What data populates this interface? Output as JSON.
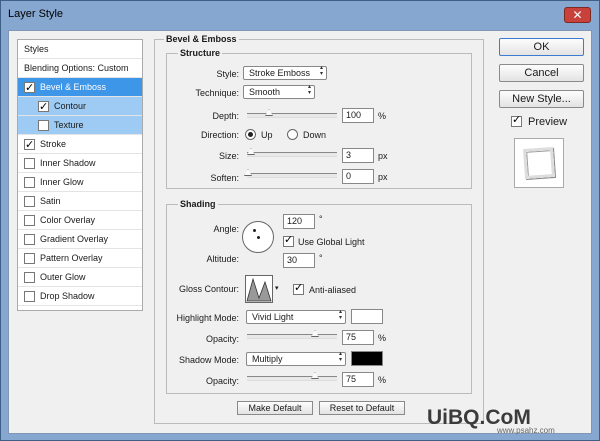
{
  "window": {
    "title": "Layer Style",
    "close_glyph": "✕"
  },
  "styles_panel": {
    "header": "Styles",
    "blending": "Blending Options: Custom",
    "items": [
      {
        "label": "Bevel & Emboss",
        "checked": true
      },
      {
        "label": "Contour",
        "checked": true
      },
      {
        "label": "Texture",
        "checked": false
      },
      {
        "label": "Stroke",
        "checked": true
      },
      {
        "label": "Inner Shadow",
        "checked": false
      },
      {
        "label": "Inner Glow",
        "checked": false
      },
      {
        "label": "Satin",
        "checked": false
      },
      {
        "label": "Color Overlay",
        "checked": false
      },
      {
        "label": "Gradient Overlay",
        "checked": false
      },
      {
        "label": "Pattern Overlay",
        "checked": false
      },
      {
        "label": "Outer Glow",
        "checked": false
      },
      {
        "label": "Drop Shadow",
        "checked": false
      }
    ]
  },
  "bevel": {
    "title": "Bevel & Emboss",
    "structure": {
      "title": "Structure",
      "style_label": "Style:",
      "style_value": "Stroke Emboss",
      "technique_label": "Technique:",
      "technique_value": "Smooth",
      "depth_label": "Depth:",
      "depth_value": "100",
      "depth_unit": "%",
      "direction_label": "Direction:",
      "dir_up": "Up",
      "dir_down": "Down",
      "size_label": "Size:",
      "size_value": "3",
      "size_unit": "px",
      "soften_label": "Soften:",
      "soften_value": "0",
      "soften_unit": "px"
    },
    "shading": {
      "title": "Shading",
      "angle_label": "Angle:",
      "angle_value": "120",
      "deg": "°",
      "global_light": "Use Global Light",
      "altitude_label": "Altitude:",
      "altitude_value": "30",
      "gloss_label": "Gloss Contour:",
      "anti_aliased": "Anti-aliased",
      "highlight_label": "Highlight Mode:",
      "highlight_value": "Vivid Light",
      "highlight_color": "#ffffff",
      "hl_opacity_label": "Opacity:",
      "hl_opacity_value": "75",
      "pct": "%",
      "shadow_label": "Shadow Mode:",
      "shadow_value": "Multiply",
      "shadow_color": "#000000",
      "sh_opacity_label": "Opacity:",
      "sh_opacity_value": "75"
    },
    "make_default": "Make Default",
    "reset_default": "Reset to Default"
  },
  "buttons": {
    "ok": "OK",
    "cancel": "Cancel",
    "new_style": "New Style...",
    "preview": "Preview"
  },
  "watermark": {
    "brand": "UiBQ.CoM",
    "url": "www.psahz.com"
  }
}
